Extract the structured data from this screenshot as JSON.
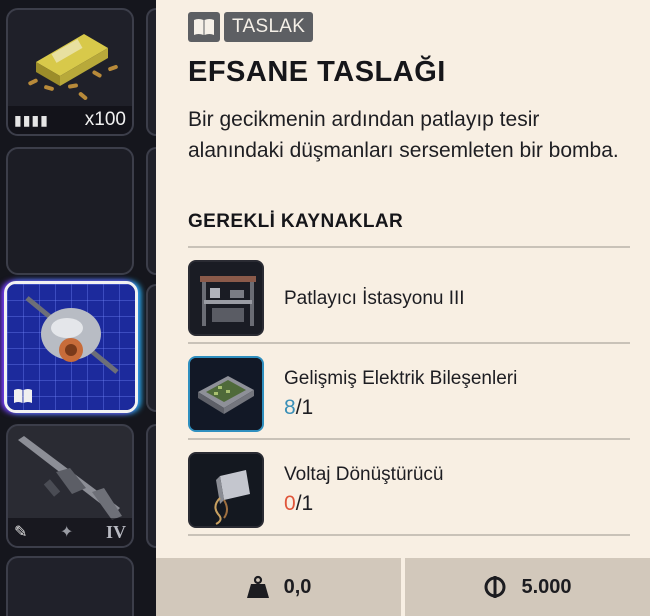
{
  "inventory": {
    "slots": [
      {
        "quantity": "x100"
      },
      {},
      {},
      {
        "tier": "IV"
      }
    ]
  },
  "detail": {
    "tag": "TASLAK",
    "title": "EFSANE TASLAĞI",
    "description": "Bir gecikmenin ardından patlayıp tesir alanındaki düşmanları sersemleten bir bomba.",
    "resources_heading": "GEREKLİ KAYNAKLAR",
    "resources": [
      {
        "name": "Patlayıcı İstasyonu III"
      },
      {
        "name": "Gelişmiş Elektrik Bileşenleri",
        "have": "8",
        "need": "/1"
      },
      {
        "name": "Voltaj Dönüştürücü",
        "have": "0",
        "need": "/1"
      }
    ]
  },
  "footer": {
    "weight": "0,0",
    "price": "5.000"
  },
  "colors": {
    "panel_bg": "#f8efe3",
    "have_ok": "#3a8fb7",
    "have_bad": "#e0553a",
    "highlight_blue": "#2f8fbf"
  }
}
